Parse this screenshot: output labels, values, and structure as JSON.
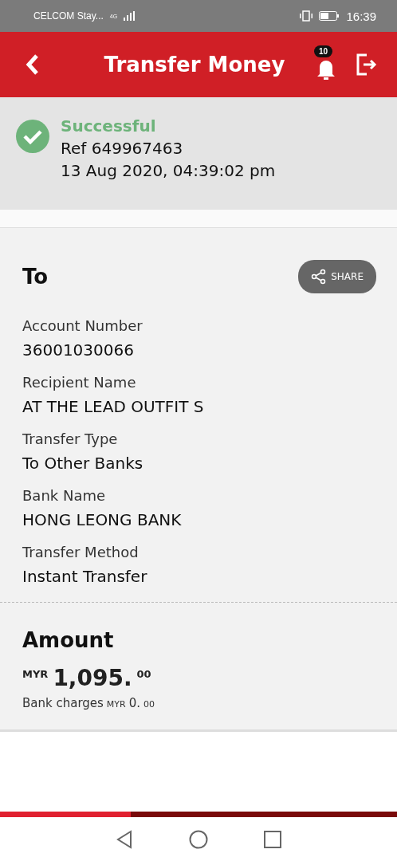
{
  "status_bar": {
    "carrier": "CELCOM Stay...",
    "network": "4G",
    "time": "16:39"
  },
  "header": {
    "title": "Transfer Money",
    "notification_count": "10"
  },
  "result": {
    "status": "Successful",
    "reference": "Ref 649967463",
    "datetime": "13 Aug 2020, 04:39:02 pm"
  },
  "recipient": {
    "heading": "To",
    "share_label": "SHARE",
    "fields": [
      {
        "label": "Account Number",
        "value": "36001030066"
      },
      {
        "label": "Recipient Name",
        "value": "AT THE LEAD OUTFIT S"
      },
      {
        "label": "Transfer Type",
        "value": "To Other Banks"
      },
      {
        "label": "Bank Name",
        "value": "HONG LEONG BANK"
      },
      {
        "label": "Transfer Method",
        "value": "Instant Transfer"
      }
    ]
  },
  "amount": {
    "heading": "Amount",
    "currency": "MYR",
    "whole": "1,095.",
    "cents": "00",
    "charges_label": "Bank charges",
    "charges_currency": "MYR",
    "charges_whole": "0.",
    "charges_cents": "00"
  },
  "progress": {
    "level": 0.33
  }
}
